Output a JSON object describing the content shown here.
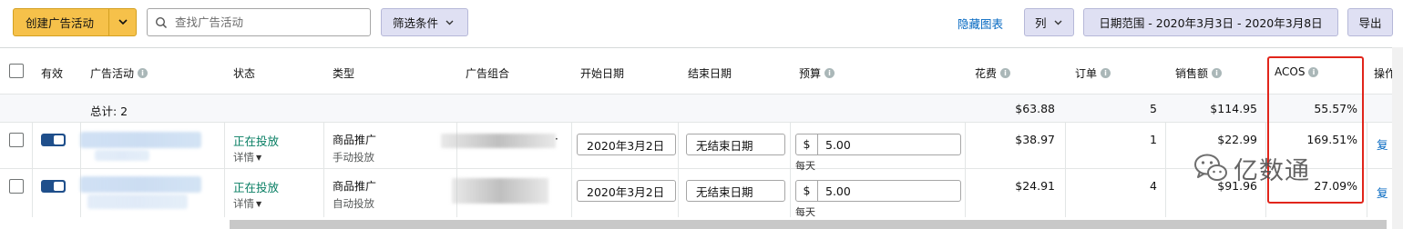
{
  "toolbar": {
    "create_label": "创建广告活动",
    "search_placeholder": "查找广告活动",
    "filter_label": "筛选条件",
    "hide_chart_label": "隐藏图表",
    "columns_label": "列",
    "date_range_label": "日期范围 - 2020年3月3日 - 2020年3月8日",
    "export_label": "导出"
  },
  "table": {
    "headers": {
      "active": "有效",
      "campaign": "广告活动",
      "status": "状态",
      "type": "类型",
      "portfolio": "广告组合",
      "start_date": "开始日期",
      "end_date": "结束日期",
      "budget": "预算",
      "spend": "花费",
      "orders": "订单",
      "sales": "销售额",
      "acos": "ACOS",
      "actions": "操作"
    },
    "total": {
      "label": "总计: 2",
      "spend": "$63.88",
      "orders": "5",
      "sales": "$114.95",
      "acos": "55.57%"
    },
    "rows": [
      {
        "status": "正在投放",
        "details": "详情",
        "type": "商品推广",
        "targeting": "手动投放",
        "portfolio_tail": "·",
        "start_date": "2020年3月2日",
        "end_date": "无结束日期",
        "currency": "$",
        "budget": "5.00",
        "budget_period": "每天",
        "spend": "$38.97",
        "orders": "1",
        "sales": "$22.99",
        "acos": "169.51%",
        "action": "复"
      },
      {
        "status": "正在投放",
        "details": "详情",
        "type": "商品推广",
        "targeting": "自动投放",
        "start_date": "2020年3月2日",
        "end_date": "无结束日期",
        "currency": "$",
        "budget": "5.00",
        "budget_period": "每天",
        "spend": "$24.91",
        "orders": "4",
        "sales": "$91.96",
        "acos": "27.09%",
        "action": "复"
      }
    ]
  },
  "watermark": {
    "text": "亿数通",
    "icon": "wechat-icon"
  },
  "colors": {
    "primary_button": "#f6c14a",
    "secondary_button": "#dfe0f3",
    "status_active": "#067d62",
    "link": "#0066c0",
    "highlight_box": "#e1251b",
    "toggle_on": "#1f4f8b"
  }
}
